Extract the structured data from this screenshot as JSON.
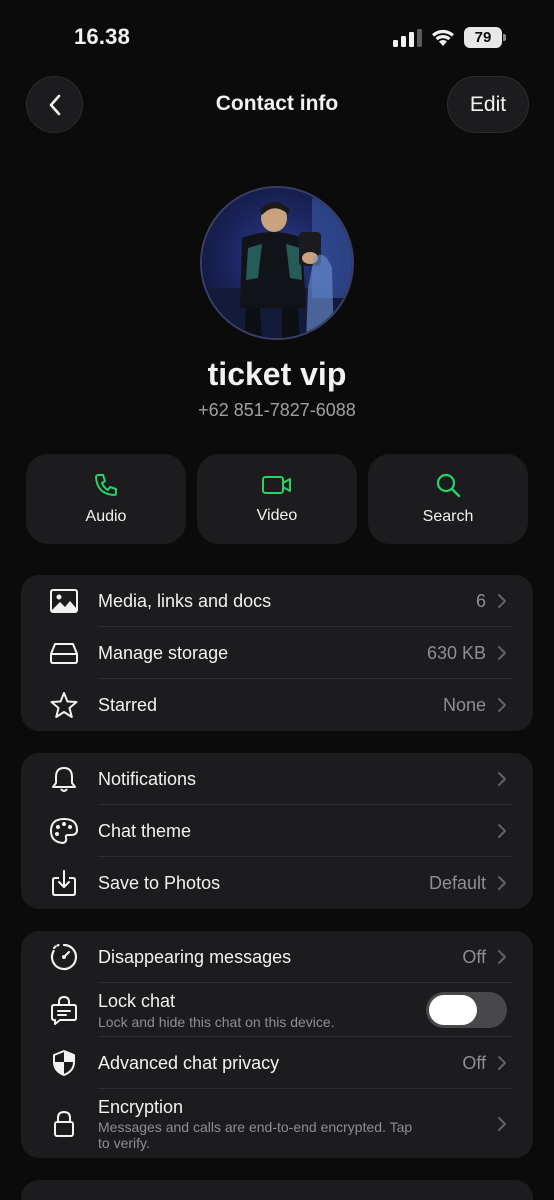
{
  "status_bar": {
    "time": "16.38",
    "battery": "79"
  },
  "nav": {
    "title": "Contact info",
    "edit_label": "Edit"
  },
  "contact": {
    "name": "ticket vip",
    "phone": "+62 851-7827-6088"
  },
  "actions": [
    {
      "label": "Audio",
      "icon": "phone-icon"
    },
    {
      "label": "Video",
      "icon": "video-icon"
    },
    {
      "label": "Search",
      "icon": "search-icon"
    }
  ],
  "group1": [
    {
      "label": "Media, links and docs",
      "value": "6",
      "icon": "image-icon"
    },
    {
      "label": "Manage storage",
      "value": "630 KB",
      "icon": "storage-icon"
    },
    {
      "label": "Starred",
      "value": "None",
      "icon": "star-icon"
    }
  ],
  "group2": [
    {
      "label": "Notifications",
      "value": "",
      "icon": "bell-icon"
    },
    {
      "label": "Chat theme",
      "value": "",
      "icon": "palette-icon"
    },
    {
      "label": "Save to Photos",
      "value": "Default",
      "icon": "download-icon"
    }
  ],
  "group3": {
    "disappearing": {
      "label": "Disappearing messages",
      "value": "Off",
      "icon": "timer-icon"
    },
    "lock_chat": {
      "label": "Lock chat",
      "sub": "Lock and hide this chat on this device.",
      "icon": "lock-chat-icon",
      "toggle": "off"
    },
    "privacy": {
      "label": "Advanced chat privacy",
      "value": "Off",
      "icon": "shield-icon"
    },
    "encryption": {
      "label": "Encryption",
      "sub_line1": "Messages and calls are end-to-end encrypted. Tap",
      "sub_line2": "to verify.",
      "icon": "lock-icon"
    }
  },
  "colors": {
    "accent": "#25d366",
    "background": "#0b0b0b",
    "card": "#1c1c1e",
    "secondary_text": "#8e8e93"
  }
}
